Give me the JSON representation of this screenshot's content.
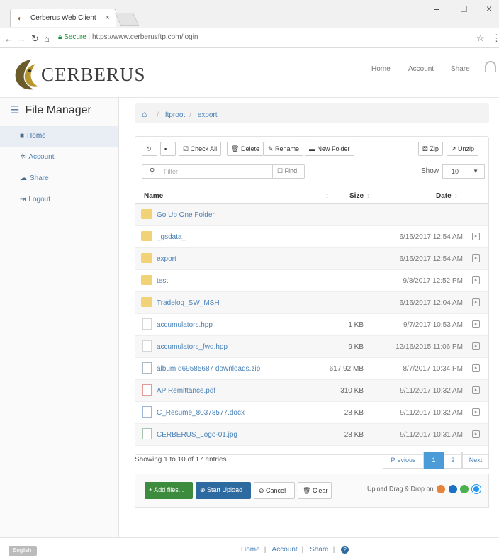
{
  "browser": {
    "tab_title": "Cerberus Web Client",
    "secure_label": "Secure",
    "url": "https://www.cerberusftp.com/login"
  },
  "header": {
    "logo_text": "CERBERUS",
    "nav": [
      "Home",
      "Account",
      "Share"
    ]
  },
  "sidebar": {
    "title": "File Manager",
    "items": [
      {
        "label": "Home",
        "icon": "folder-icon"
      },
      {
        "label": "Account",
        "icon": "gear-icon"
      },
      {
        "label": "Share",
        "icon": "cloud-icon"
      },
      {
        "label": "Logout",
        "icon": "logout-icon"
      }
    ]
  },
  "breadcrumb": {
    "items": [
      "ftproot",
      "export"
    ]
  },
  "toolbar": {
    "check_all": "Check All",
    "delete": "Delete",
    "rename": "Rename",
    "new_folder": "New Folder",
    "zip": "Zip",
    "unzip": "Unzip",
    "filter_placeholder": "Filter",
    "find": "Find",
    "show_label": "Show",
    "show_value": "10"
  },
  "table": {
    "headers": {
      "name": "Name",
      "size": "Size",
      "date": "Date"
    },
    "rows": [
      {
        "name": "Go Up One Folder",
        "size": "",
        "date": "",
        "type": "up"
      },
      {
        "name": "_gsdata_",
        "size": "",
        "date": "6/16/2017 12:54 AM",
        "type": "folder"
      },
      {
        "name": "export",
        "size": "",
        "date": "6/16/2017 12:54 AM",
        "type": "folder"
      },
      {
        "name": "test",
        "size": "",
        "date": "9/8/2017 12:52 PM",
        "type": "folder"
      },
      {
        "name": "Tradelog_SW_MSH",
        "size": "",
        "date": "6/16/2017 12:04 AM",
        "type": "folder"
      },
      {
        "name": "accumulators.hpp",
        "size": "1 KB",
        "date": "9/7/2017 10:53 AM",
        "type": "doc"
      },
      {
        "name": "accumulators_fwd.hpp",
        "size": "9 KB",
        "date": "12/16/2015 11:06 PM",
        "type": "doc"
      },
      {
        "name": "album d69585687 downloads.zip",
        "size": "617.92 MB",
        "date": "8/7/2017 10:34 PM",
        "type": "zip"
      },
      {
        "name": "AP Remittance.pdf",
        "size": "310 KB",
        "date": "9/11/2017 10:32 AM",
        "type": "pdf"
      },
      {
        "name": "C_Resume_80378577.docx",
        "size": "28 KB",
        "date": "9/11/2017 10:32 AM",
        "type": "word"
      },
      {
        "name": "CERBERUS_Logo-01.jpg",
        "size": "28 KB",
        "date": "9/11/2017 10:31 AM",
        "type": "img"
      }
    ]
  },
  "pagination": {
    "entries": "Showing 1 to 10 of 17 entries",
    "previous": "Previous",
    "page1": "1",
    "page2": "2",
    "next": "Next"
  },
  "upload": {
    "add_files": "Add files...",
    "start_upload": "Start Upload",
    "cancel": "Cancel",
    "clear": "Clear",
    "drag_drop": "Upload Drag & Drop on"
  },
  "footer": {
    "language": "English",
    "links": [
      "Home",
      "Account",
      "Share"
    ]
  },
  "colors": {
    "link": "#4a82b8",
    "primary": "#2d6aa0",
    "success": "#3d8b3d",
    "folder": "#f2d277"
  }
}
